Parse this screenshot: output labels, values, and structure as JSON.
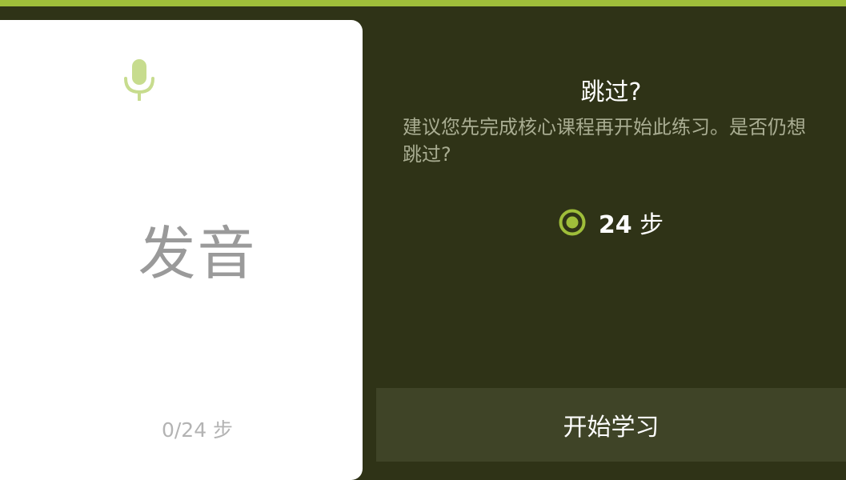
{
  "colors": {
    "accent": "#9fbe3a",
    "background": "#2f3317",
    "button_bg": "#3f4427",
    "card_bg": "#ffffff",
    "muted_text": "#a9ad92"
  },
  "card": {
    "icon": "microphone-icon",
    "title": "发音",
    "progress": "0/24 步"
  },
  "dialog": {
    "title": "跳过?",
    "description": "建议您先完成核心课程再开始此练习。是否仍想跳过?",
    "steps_icon": "radio-selected-icon",
    "steps_count": "24",
    "steps_unit": "步",
    "start_button_label": "开始学习"
  }
}
